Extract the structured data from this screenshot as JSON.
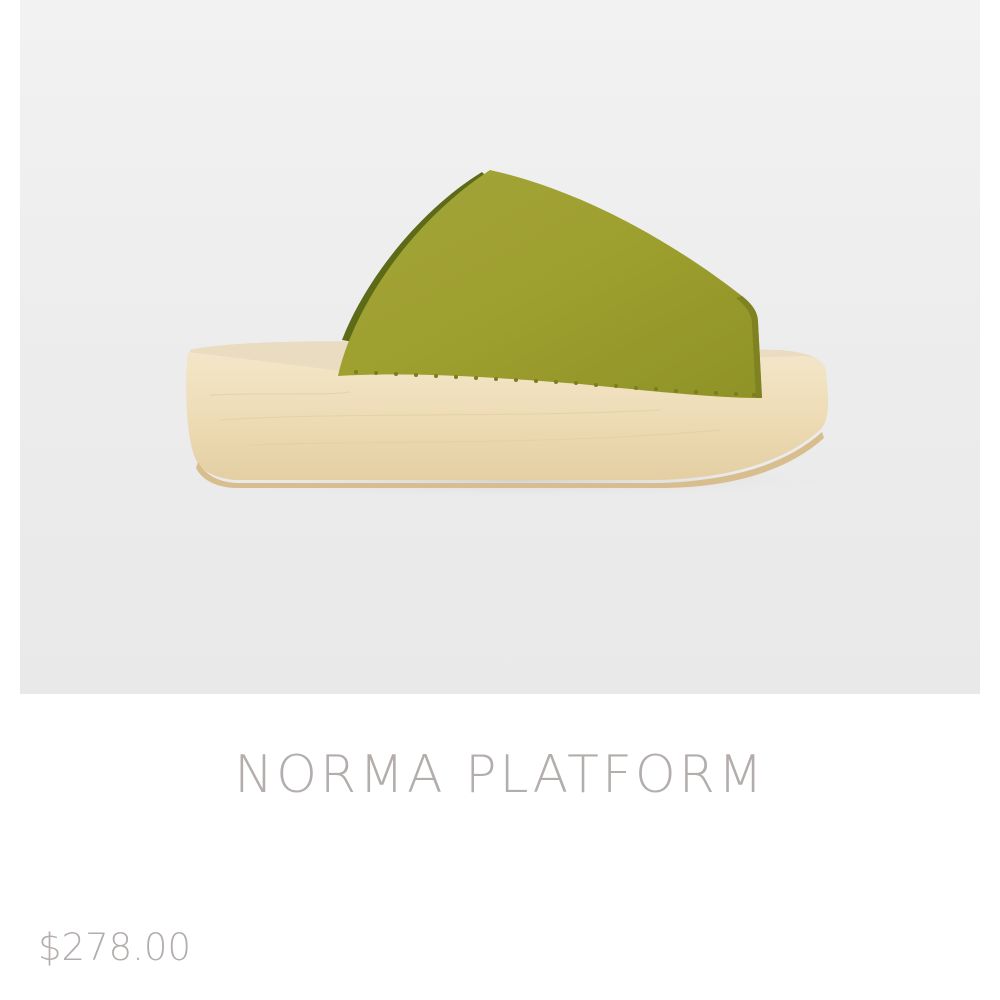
{
  "product": {
    "image_alt": "sandal-product-photo",
    "title": "NORMA PLATFORM",
    "price": "$278.00"
  },
  "colors": {
    "text": "#b3aeac",
    "upper_leather": "#9ea02c",
    "wood_base": "#efdcb4",
    "background": "#ececec"
  }
}
